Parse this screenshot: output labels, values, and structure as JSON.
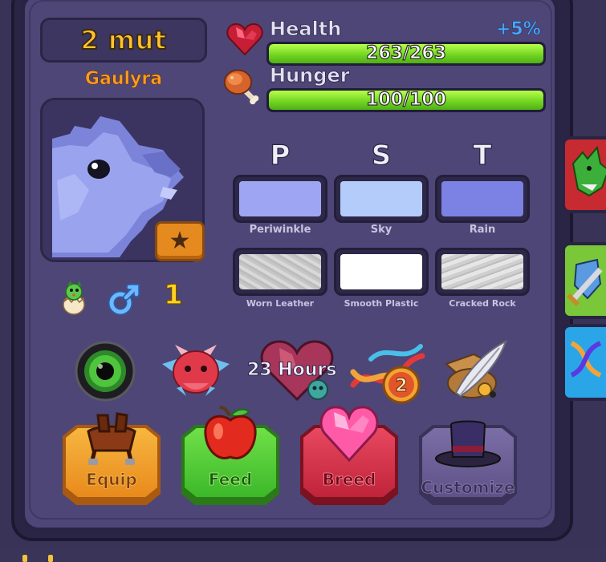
{
  "header": {
    "title": "2 mut",
    "species": "Gaulyra"
  },
  "stats": {
    "health": {
      "label": "Health",
      "value_text": "263/263",
      "fraction": 1.0,
      "bonus": "+5%"
    },
    "hunger": {
      "label": "Hunger",
      "value_text": "100/100",
      "fraction": 1.0
    }
  },
  "colors": {
    "slots": [
      "P",
      "S",
      "T"
    ],
    "swatches": [
      {
        "name": "Periwinkle",
        "hex": "#9ea6f4"
      },
      {
        "name": "Sky",
        "hex": "#b4ccfa"
      },
      {
        "name": "Rain",
        "hex": "#7b82e3"
      }
    ],
    "textures": [
      {
        "name": "Worn Leather",
        "hex": "#c8c8c8"
      },
      {
        "name": "Smooth Plastic",
        "hex": "#ffffff"
      },
      {
        "name": "Cracked Rock",
        "hex": "#d6d6d6"
      }
    ]
  },
  "badges": {
    "generation": "1",
    "gender": "male-symbol-icon",
    "age_stage": "baby-dragon-egg-icon"
  },
  "traits": {
    "eye": "green-eye-icon",
    "head": "red-dragon-head-icon",
    "breed_cooldown": "23 Hours",
    "mutations": "2",
    "accessory": "feather-hat-icon"
  },
  "actions": [
    {
      "label": "Equip",
      "color": "#f09a25"
    },
    {
      "label": "Feed",
      "color": "#4fcf2e"
    },
    {
      "label": "Breed",
      "color": "#d8334a"
    },
    {
      "label": "Customize",
      "color": "#6a5e92"
    }
  ],
  "colors_theme": {
    "panel": "#4e4677",
    "accent_gold": "#ffc22e",
    "bar_green": "#6fd220",
    "bonus_blue": "#4ea6ff"
  }
}
